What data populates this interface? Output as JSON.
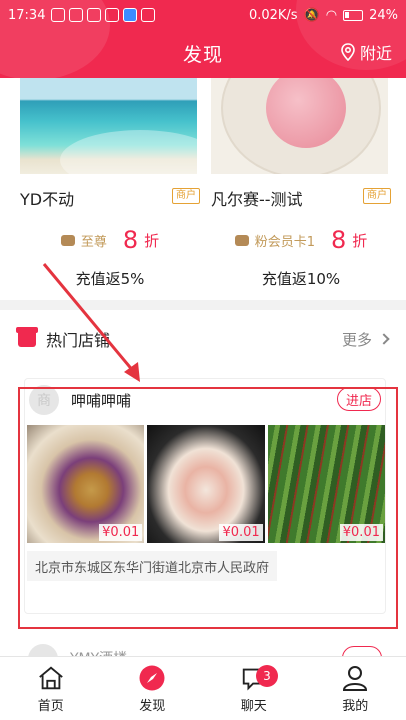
{
  "status_bar": {
    "time": "17:34",
    "speed": "0.02K/s",
    "battery": "24%"
  },
  "header": {
    "title": "发现",
    "nearby_label": "附近",
    "color": "#f0294f"
  },
  "promos": [
    {
      "name": "YD不动",
      "tag": "商户",
      "member": "至尊",
      "discount": "8",
      "discount_unit": "折",
      "recharge": "充值返5%"
    },
    {
      "name": "凡尔赛--测试",
      "tag": "商户",
      "member": "粉会员卡1",
      "discount": "8",
      "discount_unit": "折",
      "recharge": "充值返10%"
    }
  ],
  "hot_shops": {
    "title": "热门店铺",
    "more_label": "更多",
    "shop": {
      "avatar_text": "商",
      "name": "呷哺呷哺",
      "enter_label": "进店",
      "prices": [
        "¥0.01",
        "¥0.01",
        "¥0.01"
      ],
      "address": "北京市东城区东华门街道北京市人民政府"
    },
    "next_shop": {
      "name": "YMY酒楼"
    }
  },
  "tabbar": {
    "items": [
      {
        "label": "首页",
        "icon": "home-icon"
      },
      {
        "label": "发现",
        "icon": "compass-icon"
      },
      {
        "label": "聊天",
        "icon": "chat-icon",
        "badge": "3"
      },
      {
        "label": "我的",
        "icon": "user-icon"
      }
    ],
    "active": "发现"
  }
}
